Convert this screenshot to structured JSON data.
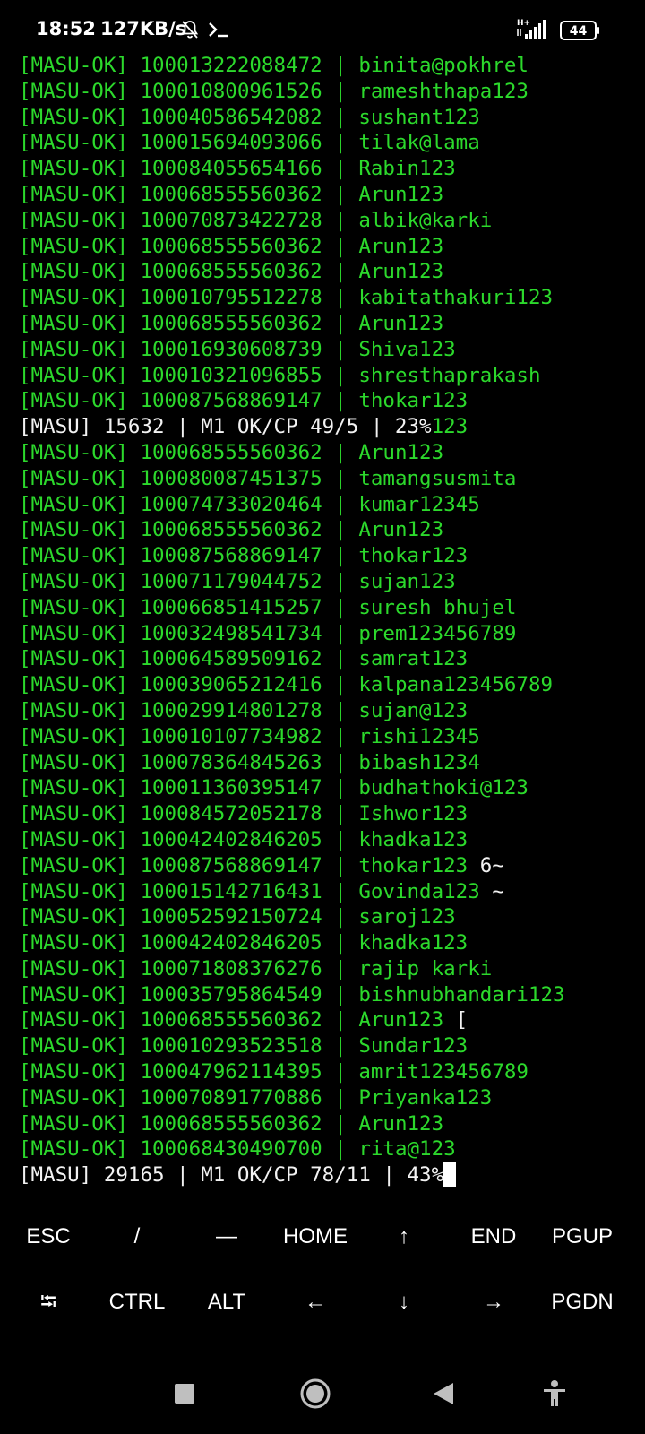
{
  "status_bar": {
    "time": "18:52",
    "net_speed": "127KB/s",
    "network_type": "H+",
    "battery": "44",
    "icons": [
      "mute-bell-icon",
      "terminal-prompt-icon",
      "signal-icon",
      "battery-icon"
    ]
  },
  "terminal": {
    "colors": {
      "ok": "#2cd92c",
      "progress": "#f2f2f2",
      "background": "#000000"
    },
    "lines": [
      {
        "type": "ok",
        "tag": "[MASU-OK]",
        "id": "100013222088472",
        "sep": "|",
        "password": "binita@pokhrel",
        "trail": ""
      },
      {
        "type": "ok",
        "tag": "[MASU-OK]",
        "id": "100010800961526",
        "sep": "|",
        "password": "rameshthapa123",
        "trail": ""
      },
      {
        "type": "ok",
        "tag": "[MASU-OK]",
        "id": "100040586542082",
        "sep": "|",
        "password": "sushant123",
        "trail": ""
      },
      {
        "type": "ok",
        "tag": "[MASU-OK]",
        "id": "100015694093066",
        "sep": "|",
        "password": "tilak@lama",
        "trail": ""
      },
      {
        "type": "ok",
        "tag": "[MASU-OK]",
        "id": "100084055654166",
        "sep": "|",
        "password": "Rabin123",
        "trail": ""
      },
      {
        "type": "ok",
        "tag": "[MASU-OK]",
        "id": "100068555560362",
        "sep": "|",
        "password": "Arun123",
        "trail": ""
      },
      {
        "type": "ok",
        "tag": "[MASU-OK]",
        "id": "100070873422728",
        "sep": "|",
        "password": "albik@karki",
        "trail": ""
      },
      {
        "type": "ok",
        "tag": "[MASU-OK]",
        "id": "100068555560362",
        "sep": "|",
        "password": "Arun123",
        "trail": ""
      },
      {
        "type": "ok",
        "tag": "[MASU-OK]",
        "id": "100068555560362",
        "sep": "|",
        "password": "Arun123",
        "trail": ""
      },
      {
        "type": "ok",
        "tag": "[MASU-OK]",
        "id": "100010795512278",
        "sep": "|",
        "password": "kabitathakuri123",
        "trail": ""
      },
      {
        "type": "ok",
        "tag": "[MASU-OK]",
        "id": "100068555560362",
        "sep": "|",
        "password": "Arun123",
        "trail": ""
      },
      {
        "type": "ok",
        "tag": "[MASU-OK]",
        "id": "100016930608739",
        "sep": "|",
        "password": "Shiva123",
        "trail": ""
      },
      {
        "type": "ok",
        "tag": "[MASU-OK]",
        "id": "100010321096855",
        "sep": "|",
        "password": "shresthaprakash",
        "trail": ""
      },
      {
        "type": "ok",
        "tag": "[MASU-OK]",
        "id": "100087568869147",
        "sep": "|",
        "password": "thokar123",
        "trail": ""
      },
      {
        "type": "progress",
        "text": "[MASU] 15632 | M1 OK/CP 49/5 | 23%",
        "tail": "123"
      },
      {
        "type": "ok",
        "tag": "[MASU-OK]",
        "id": "100068555560362",
        "sep": "|",
        "password": "Arun123",
        "trail": ""
      },
      {
        "type": "ok",
        "tag": "[MASU-OK]",
        "id": "100080087451375",
        "sep": "|",
        "password": "tamangsusmita",
        "trail": ""
      },
      {
        "type": "ok",
        "tag": "[MASU-OK]",
        "id": "100074733020464",
        "sep": "|",
        "password": "kumar12345",
        "trail": ""
      },
      {
        "type": "ok",
        "tag": "[MASU-OK]",
        "id": "100068555560362",
        "sep": "|",
        "password": "Arun123",
        "trail": ""
      },
      {
        "type": "ok",
        "tag": "[MASU-OK]",
        "id": "100087568869147",
        "sep": "|",
        "password": "thokar123",
        "trail": ""
      },
      {
        "type": "ok",
        "tag": "[MASU-OK]",
        "id": "100071179044752",
        "sep": "|",
        "password": "sujan123",
        "trail": ""
      },
      {
        "type": "ok",
        "tag": "[MASU-OK]",
        "id": "100066851415257",
        "sep": "|",
        "password": "suresh bhujel",
        "trail": ""
      },
      {
        "type": "ok",
        "tag": "[MASU-OK]",
        "id": "100032498541734",
        "sep": "|",
        "password": "prem123456789",
        "trail": ""
      },
      {
        "type": "ok",
        "tag": "[MASU-OK]",
        "id": "100064589509162",
        "sep": "|",
        "password": "samrat123",
        "trail": ""
      },
      {
        "type": "ok",
        "tag": "[MASU-OK]",
        "id": "100039065212416",
        "sep": "|",
        "password": "kalpana123456789",
        "trail": ""
      },
      {
        "type": "ok",
        "tag": "[MASU-OK]",
        "id": "100029914801278",
        "sep": "|",
        "password": "sujan@123",
        "trail": ""
      },
      {
        "type": "ok",
        "tag": "[MASU-OK]",
        "id": "100010107734982",
        "sep": "|",
        "password": "rishi12345",
        "trail": ""
      },
      {
        "type": "ok",
        "tag": "[MASU-OK]",
        "id": "100078364845263",
        "sep": "|",
        "password": "bibash1234",
        "trail": ""
      },
      {
        "type": "ok",
        "tag": "[MASU-OK]",
        "id": "100011360395147",
        "sep": "|",
        "password": "budhathoki@123",
        "trail": ""
      },
      {
        "type": "ok",
        "tag": "[MASU-OK]",
        "id": "100084572052178",
        "sep": "|",
        "password": "Ishwor123",
        "trail": ""
      },
      {
        "type": "ok",
        "tag": "[MASU-OK]",
        "id": "100042402846205",
        "sep": "|",
        "password": "khadka123",
        "trail": ""
      },
      {
        "type": "ok",
        "tag": "[MASU-OK]",
        "id": "100087568869147",
        "sep": "|",
        "password": "thokar123",
        "trail": " 6~"
      },
      {
        "type": "ok",
        "tag": "[MASU-OK]",
        "id": "100015142716431",
        "sep": "|",
        "password": "Govinda123",
        "trail": " ~"
      },
      {
        "type": "ok",
        "tag": "[MASU-OK]",
        "id": "100052592150724",
        "sep": "|",
        "password": "saroj123",
        "trail": ""
      },
      {
        "type": "ok",
        "tag": "[MASU-OK]",
        "id": "100042402846205",
        "sep": "|",
        "password": "khadka123",
        "trail": ""
      },
      {
        "type": "ok",
        "tag": "[MASU-OK]",
        "id": "100071808376276",
        "sep": "|",
        "password": "rajip karki",
        "trail": ""
      },
      {
        "type": "ok",
        "tag": "[MASU-OK]",
        "id": "100035795864549",
        "sep": "|",
        "password": "bishnubhandari123",
        "trail": ""
      },
      {
        "type": "ok",
        "tag": "[MASU-OK]",
        "id": "100068555560362",
        "sep": "|",
        "password": "Arun123",
        "trail": " ["
      },
      {
        "type": "ok",
        "tag": "[MASU-OK]",
        "id": "100010293523518",
        "sep": "|",
        "password": "Sundar123",
        "trail": ""
      },
      {
        "type": "ok",
        "tag": "[MASU-OK]",
        "id": "100047962114395",
        "sep": "|",
        "password": "amrit123456789",
        "trail": ""
      },
      {
        "type": "ok",
        "tag": "[MASU-OK]",
        "id": "100070891770886",
        "sep": "|",
        "password": "Priyanka123",
        "trail": ""
      },
      {
        "type": "ok",
        "tag": "[MASU-OK]",
        "id": "100068555560362",
        "sep": "|",
        "password": "Arun123",
        "trail": ""
      },
      {
        "type": "ok",
        "tag": "[MASU-OK]",
        "id": "100068430490700",
        "sep": "|",
        "password": "rita@123",
        "trail": ""
      },
      {
        "type": "progress",
        "text": "[MASU] 29165 | M1 OK/CP 78/11 | 43%",
        "tail": "",
        "cursor": true
      }
    ]
  },
  "extra_keys": {
    "row1": [
      {
        "label": "ESC",
        "name": "key-esc"
      },
      {
        "label": "/",
        "name": "key-slash"
      },
      {
        "label": "—",
        "name": "key-dash"
      },
      {
        "label": "HOME",
        "name": "key-home"
      },
      {
        "label": "↑",
        "name": "key-up"
      },
      {
        "label": "END",
        "name": "key-end"
      },
      {
        "label": "PGUP",
        "name": "key-pgup"
      }
    ],
    "row2": [
      {
        "label": "⭾",
        "name": "key-tab"
      },
      {
        "label": "CTRL",
        "name": "key-ctrl"
      },
      {
        "label": "ALT",
        "name": "key-alt"
      },
      {
        "label": "←",
        "name": "key-left"
      },
      {
        "label": "↓",
        "name": "key-down"
      },
      {
        "label": "→",
        "name": "key-right"
      },
      {
        "label": "PGDN",
        "name": "key-pgdn"
      }
    ]
  },
  "nav_bar": {
    "buttons": [
      "recents-square-icon",
      "home-circle-icon",
      "back-triangle-icon",
      "accessibility-icon"
    ]
  }
}
